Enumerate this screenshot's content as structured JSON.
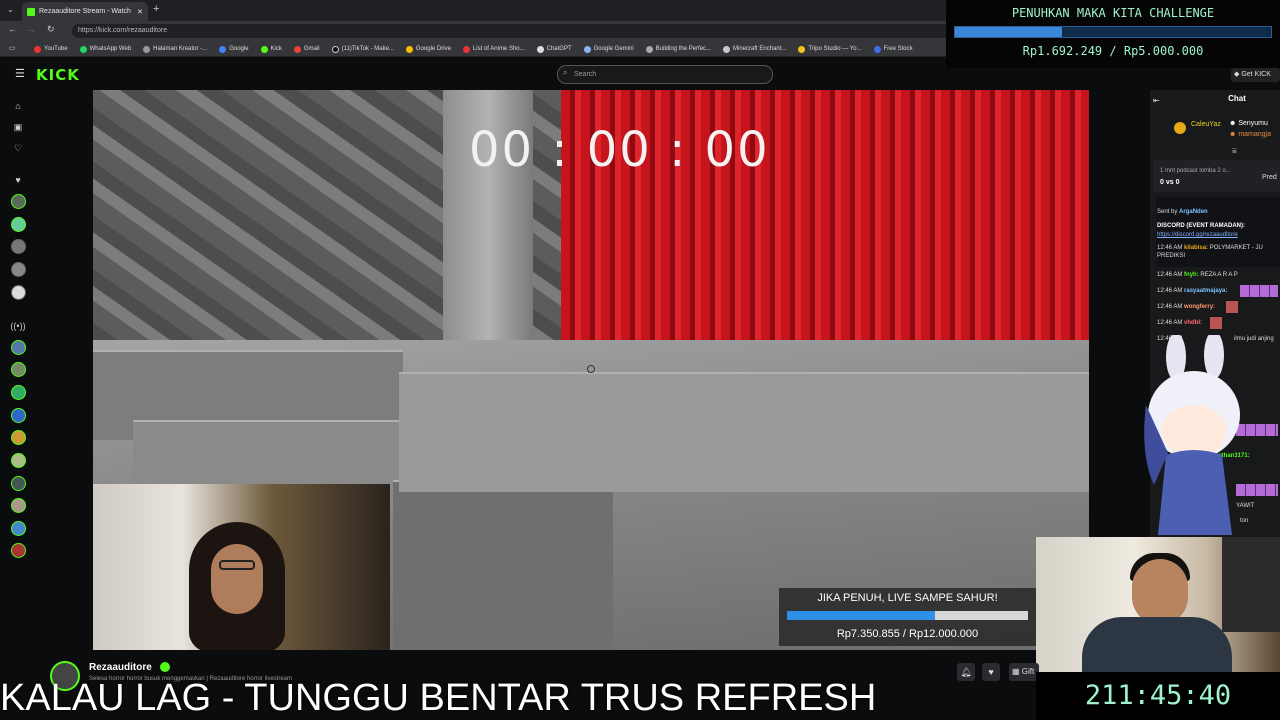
{
  "browser": {
    "tab_title": "Rezaauditore Stream - Watch",
    "url": "https://kick.com/rezaauditore",
    "bookmarks": [
      "YouTube",
      "WhatsApp Web",
      "Halaman Kreator -...",
      "Google",
      "Kick",
      "Gmail",
      "(11)TikTok - Make...",
      "Google Drive",
      "List of Anime Sho...",
      "ChatGPT",
      "Google Gemini",
      "Building the Perfec...",
      "Minecraft Enchant...",
      "Tripo Studio — Yo...",
      "Free Stock"
    ]
  },
  "kick": {
    "logo": "KICK",
    "search_placeholder": "Search",
    "get_kick": "Get KICK"
  },
  "game": {
    "timer": "00 : 00 : 00"
  },
  "goal_top": {
    "title": "PENUHKAN MAKA KITA CHALLENGE",
    "current": "Rp1.692.249",
    "target": "Rp5.000.000",
    "separator": " / ",
    "progress": 0.338
  },
  "goal_bottom": {
    "title": "JIKA PENUH, LIVE SAMPE SAHUR!",
    "amount": "Rp7.350.855 / Rp12.000.000",
    "progress": 0.6126
  },
  "chat": {
    "title": "Chat",
    "pinned_user": "CaleuYaz",
    "pinned_right": "Senyumu",
    "pinned_right2": "mamangja",
    "poll": "1 mnt podcast lomba 2 o...",
    "poll_score": "0 vs 0",
    "pred": "Pred",
    "sent_by": "Sent by",
    "sent_by_user": "ArgaNden",
    "discord_label": "DISCORD (EVENT RAMADAN):",
    "discord_link": "https://discord.gg/rezaauditore",
    "messages": [
      {
        "time": "12:46 AM",
        "user": "kilabisa:",
        "text": "POLYMARKET - JU PREDIKSI"
      },
      {
        "time": "12:46 AM",
        "user": "fnyh:",
        "text": "REZA A R A P"
      },
      {
        "time": "12:46 AM",
        "user": "rasyaatmajaya:",
        "text": ""
      },
      {
        "time": "12:46 AM",
        "user": "wongferry:",
        "text": ""
      },
      {
        "time": "12:46 AM",
        "user": "vhdbl:",
        "text": ""
      },
      {
        "time": "12:46 AM",
        "user": "",
        "text": "ilmu judi anjing"
      },
      {
        "time": "",
        "user": "eviathan3171:",
        "text": ""
      },
      {
        "time": "",
        "user": "",
        "text": "YAWIT"
      },
      {
        "time": "",
        "user": "",
        "text": "ton"
      }
    ]
  },
  "stream": {
    "streamer": "Rezaauditore",
    "title": "Selesa horror horror busuk menggemaskan | Rezaauditore horror livestream",
    "gift": "Gift"
  },
  "overlay": {
    "ticker": "KALAU LAG - TUNGGU BENTAR TRUS REFRESH",
    "clock": "211:45:40"
  }
}
